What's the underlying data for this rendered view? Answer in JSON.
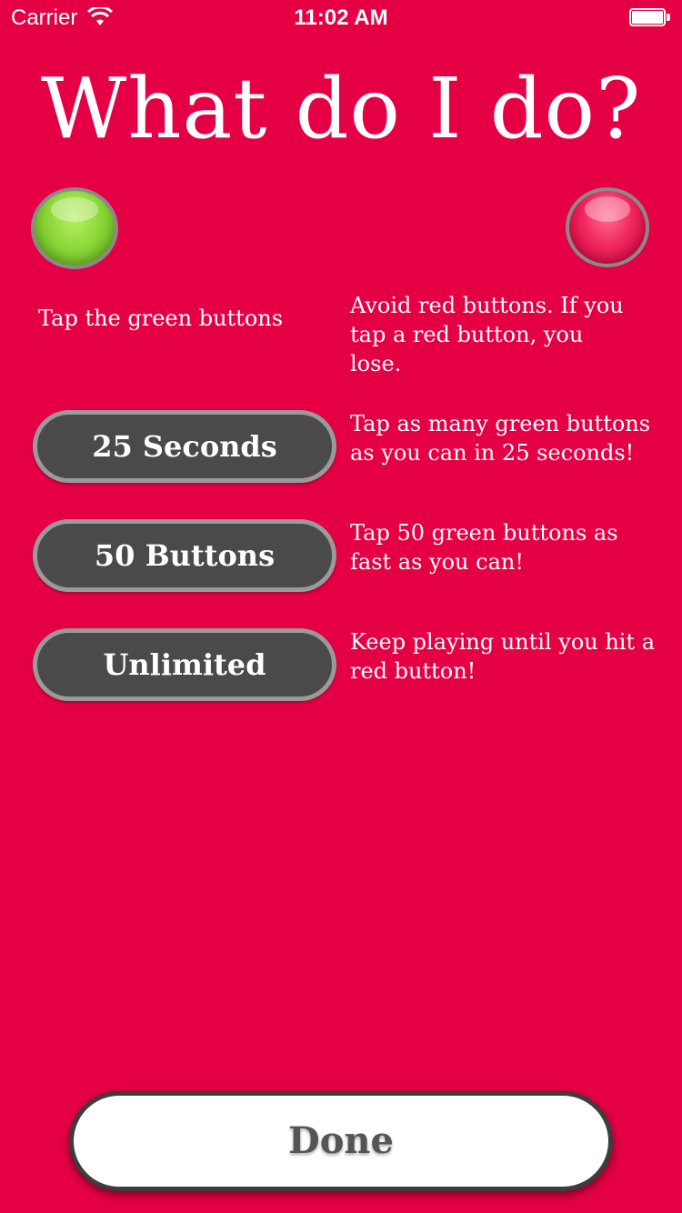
{
  "status_bar": {
    "carrier": "Carrier",
    "time": "11:02 AM"
  },
  "title": "What do I do?",
  "instructions": {
    "green_text": "Tap the green buttons",
    "red_text": "Avoid red buttons. If you tap a red button, you lose."
  },
  "modes": [
    {
      "label": "25 Seconds",
      "description": "Tap as many green buttons as you can in 25 seconds!"
    },
    {
      "label": "50 Buttons",
      "description": "Tap 50 green buttons as fast as you can!"
    },
    {
      "label": "Unlimited",
      "description": "Keep playing until you hit a red button!"
    }
  ],
  "done_label": "Done",
  "colors": {
    "background": "#e50045",
    "mode_button": "#4a4a4a",
    "green_orb": "#8fd83a",
    "red_orb": "#f0275e"
  }
}
